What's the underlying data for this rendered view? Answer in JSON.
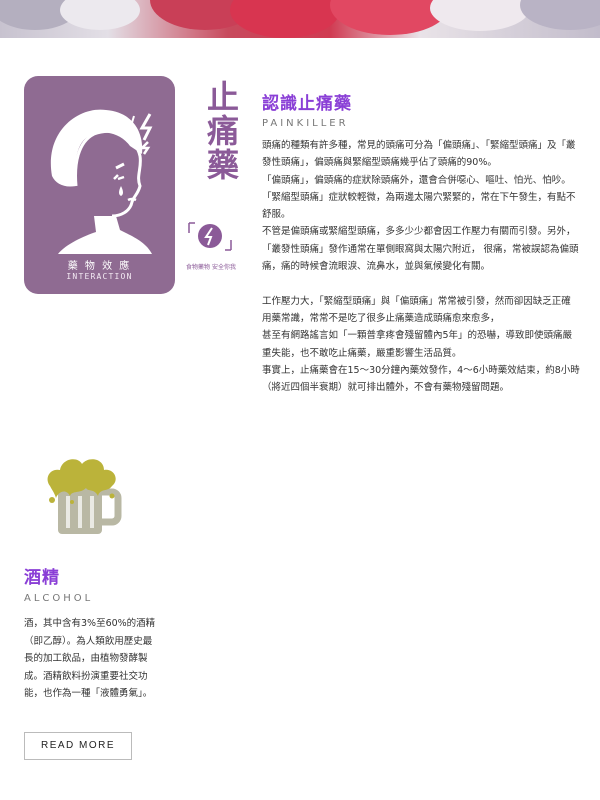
{
  "colors": {
    "accent": "#8a3fd6",
    "card_bg": "#8f6b92",
    "vertical_title": "#8b5a98",
    "beer_foam": "#bbb33a",
    "beer_mug": "#b9b8a4"
  },
  "painkiller": {
    "card_zh": "藥 物 效 應",
    "card_en": "INTERACTION",
    "vertical_title": [
      "止",
      "痛",
      "藥"
    ],
    "badge_label": "食物藥物 安全你我",
    "badge_icon": "lightning-icon",
    "title": "認識止痛藥",
    "subtitle": "PAINKILLER",
    "paragraphs": [
      "頭痛的種類有許多種，常見的頭痛可分為「偏頭痛」、「緊縮型頭痛」及「叢發性頭痛」，偏頭痛與緊縮型頭痛幾乎佔了頭痛的90%。",
      "「偏頭痛」，偏頭痛的症狀除頭痛外，還會合併噁心、嘔吐、怕光、怕吵。",
      "「緊縮型頭痛」症狀較輕微，為兩邊太陽穴緊緊的，常在下午發生，有點不舒服。",
      "不管是偏頭痛或緊縮型頭痛，多多少少都會因工作壓力有關而引發。另外，「叢發性頭痛」發作通常在單側眼窩與太陽穴附近， 很痛，常被誤認為偏頭痛，痛的時候會流眼淚、流鼻水，並與氣候變化有關。",
      "",
      "工作壓力大，「緊縮型頭痛」與「偏頭痛」常常被引發，然而卻因缺乏正確用藥常識，常常不是吃了很多止痛藥造成頭痛愈來愈多，",
      "甚至有網路謠言如「一顆普拿疼會殘留體內5年」的恐嚇，導致即使頭痛嚴重失能，也不敢吃止痛藥，嚴重影響生活品質。",
      "事實上，止痛藥會在15～30分鐘內藥效發作，4～6小時藥效結束，約8小時（將近四個半衰期）就可排出體外，不會有藥物殘留問題。"
    ]
  },
  "alcohol": {
    "icon": "beer-mug-icon",
    "title": "酒精",
    "subtitle": "ALCOHOL",
    "description": "酒，其中含有3%至60%的酒精（即乙醇）。為人類飲用歷史最長的加工飲品，由植物發酵製成。酒精飲料扮演重要社交功能，也作為一種「液體勇氣」。",
    "read_more": "READ MORE"
  }
}
